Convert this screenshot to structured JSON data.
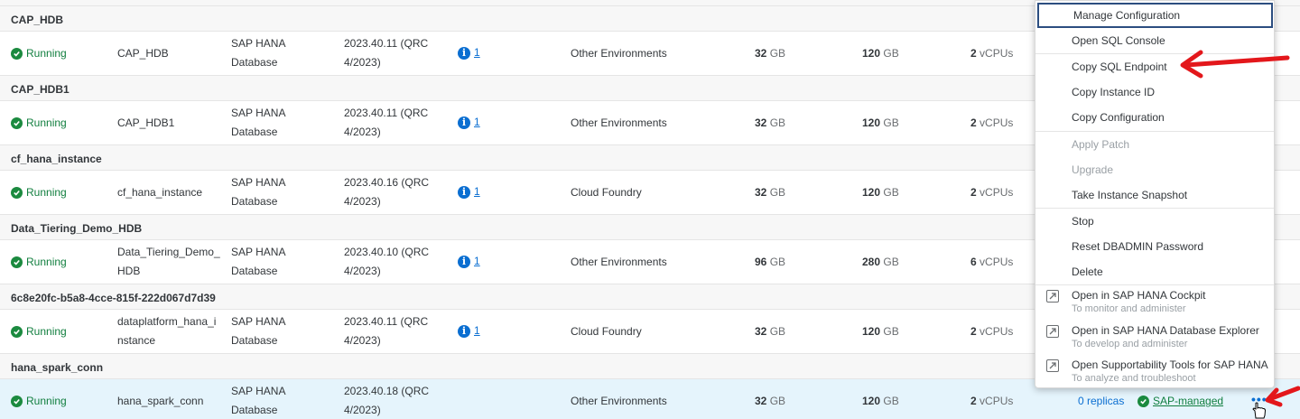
{
  "groups": [
    {
      "title": "CAP_HDB",
      "status": "Running",
      "name_lines": [
        "CAP_HDB"
      ],
      "type_lines": [
        "SAP HANA",
        "Database"
      ],
      "version_lines": [
        "2023.40.11 (QRC",
        "4/2023)"
      ],
      "info_count": "1",
      "environment": "Other Environments",
      "memory": "32",
      "storage": "120",
      "vcpus": "2"
    },
    {
      "title": "CAP_HDB1",
      "status": "Running",
      "name_lines": [
        "CAP_HDB1"
      ],
      "type_lines": [
        "SAP HANA",
        "Database"
      ],
      "version_lines": [
        "2023.40.11 (QRC",
        "4/2023)"
      ],
      "info_count": "1",
      "environment": "Other Environments",
      "memory": "32",
      "storage": "120",
      "vcpus": "2"
    },
    {
      "title": "cf_hana_instance",
      "status": "Running",
      "name_lines": [
        "cf_hana_instance"
      ],
      "type_lines": [
        "SAP HANA",
        "Database"
      ],
      "version_lines": [
        "2023.40.16 (QRC",
        "4/2023)"
      ],
      "info_count": "1",
      "environment": "Cloud Foundry",
      "memory": "32",
      "storage": "120",
      "vcpus": "2"
    },
    {
      "title": "Data_Tiering_Demo_HDB",
      "status": "Running",
      "name_lines": [
        "Data_Tiering_Demo_",
        "HDB"
      ],
      "type_lines": [
        "SAP HANA",
        "Database"
      ],
      "version_lines": [
        "2023.40.10 (QRC",
        "4/2023)"
      ],
      "info_count": "1",
      "environment": "Other Environments",
      "memory": "96",
      "storage": "280",
      "vcpus": "6"
    },
    {
      "title": "6c8e20fc-b5a8-4cce-815f-222d067d7d39",
      "status": "Running",
      "name_lines": [
        "dataplatform_hana_i",
        "nstance"
      ],
      "type_lines": [
        "SAP HANA",
        "Database"
      ],
      "version_lines": [
        "2023.40.11 (QRC",
        "4/2023)"
      ],
      "info_count": "1",
      "environment": "Cloud Foundry",
      "memory": "32",
      "storage": "120",
      "vcpus": "2"
    },
    {
      "title": "hana_spark_conn",
      "status": "Running",
      "name_lines": [
        "hana_spark_conn"
      ],
      "type_lines": [
        "SAP HANA",
        "Database"
      ],
      "version_lines": [
        "2023.40.18 (QRC",
        "4/2023)"
      ],
      "info_count": "1",
      "environment": "Other Environments",
      "memory": "32",
      "storage": "120",
      "vcpus": "2",
      "replicas": "0 replicas",
      "managed": "SAP-managed",
      "actions": "•••"
    }
  ],
  "units": {
    "memory": "GB",
    "storage": "GB",
    "vcpus": "vCPUs"
  },
  "menu": {
    "items": [
      {
        "label": "Manage Configuration",
        "disabled": false
      },
      {
        "label": "Open SQL Console",
        "disabled": false
      },
      {
        "label": "Copy SQL Endpoint",
        "disabled": false
      },
      {
        "label": "Copy Instance ID",
        "disabled": false
      },
      {
        "label": "Copy Configuration",
        "disabled": false
      },
      {
        "label": "Apply Patch",
        "disabled": true
      },
      {
        "label": "Upgrade",
        "disabled": true
      },
      {
        "label": "Take Instance Snapshot",
        "disabled": false
      },
      {
        "label": "Stop",
        "disabled": false
      },
      {
        "label": "Reset DBADMIN Password",
        "disabled": false
      },
      {
        "label": "Delete",
        "disabled": false
      }
    ],
    "links": [
      {
        "title": "Open in SAP HANA Cockpit",
        "subtitle": "To monitor and administer"
      },
      {
        "title": "Open in SAP HANA Database Explorer",
        "subtitle": "To develop and administer"
      },
      {
        "title": "Open Supportability Tools for SAP HANA",
        "subtitle": "To analyze and troubleshoot"
      }
    ]
  },
  "colors": {
    "success": "#107e3e",
    "link": "#0a6ed1",
    "focus": "#2c4e80",
    "annotation": "#e3171b",
    "selected_row": "#e5f4fc"
  }
}
